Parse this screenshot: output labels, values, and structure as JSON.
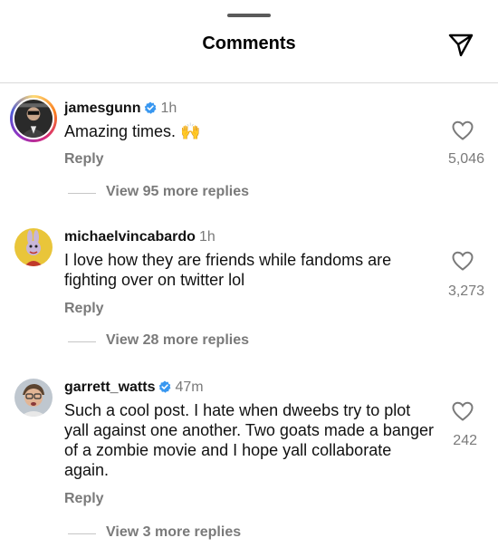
{
  "header": {
    "title": "Comments",
    "send_icon": "paper-plane-icon"
  },
  "colors": {
    "verified": "#3897f0",
    "secondary_text": "#7a7a7a",
    "story_ring": [
      "#feda75",
      "#fa7e1e",
      "#d62976",
      "#962fbf",
      "#4f5bd5"
    ]
  },
  "comments": [
    {
      "username": "jamesgunn",
      "verified": true,
      "time": "1h",
      "text": "Amazing times. 🙌",
      "reply_label": "Reply",
      "likes": "5,046",
      "view_replies": "View 95 more replies",
      "avatar": "james-gunn-avatar"
    },
    {
      "username": "michaelvincabardo",
      "verified": false,
      "time": "1h",
      "text": "I love how they are friends while fandoms are fighting over on twitter lol",
      "reply_label": "Reply",
      "likes": "3,273",
      "view_replies": "View 28 more replies",
      "avatar": "cartoon-rabbit-avatar"
    },
    {
      "username": "garrett_watts",
      "verified": true,
      "time": "47m",
      "text": "Such a cool post. I hate when dweebs try to plot yall against one another. Two goats made a banger of a zombie movie and I hope yall collaborate again.",
      "reply_label": "Reply",
      "likes": "242",
      "view_replies": "View 3 more replies",
      "avatar": "garrett-avatar"
    }
  ]
}
